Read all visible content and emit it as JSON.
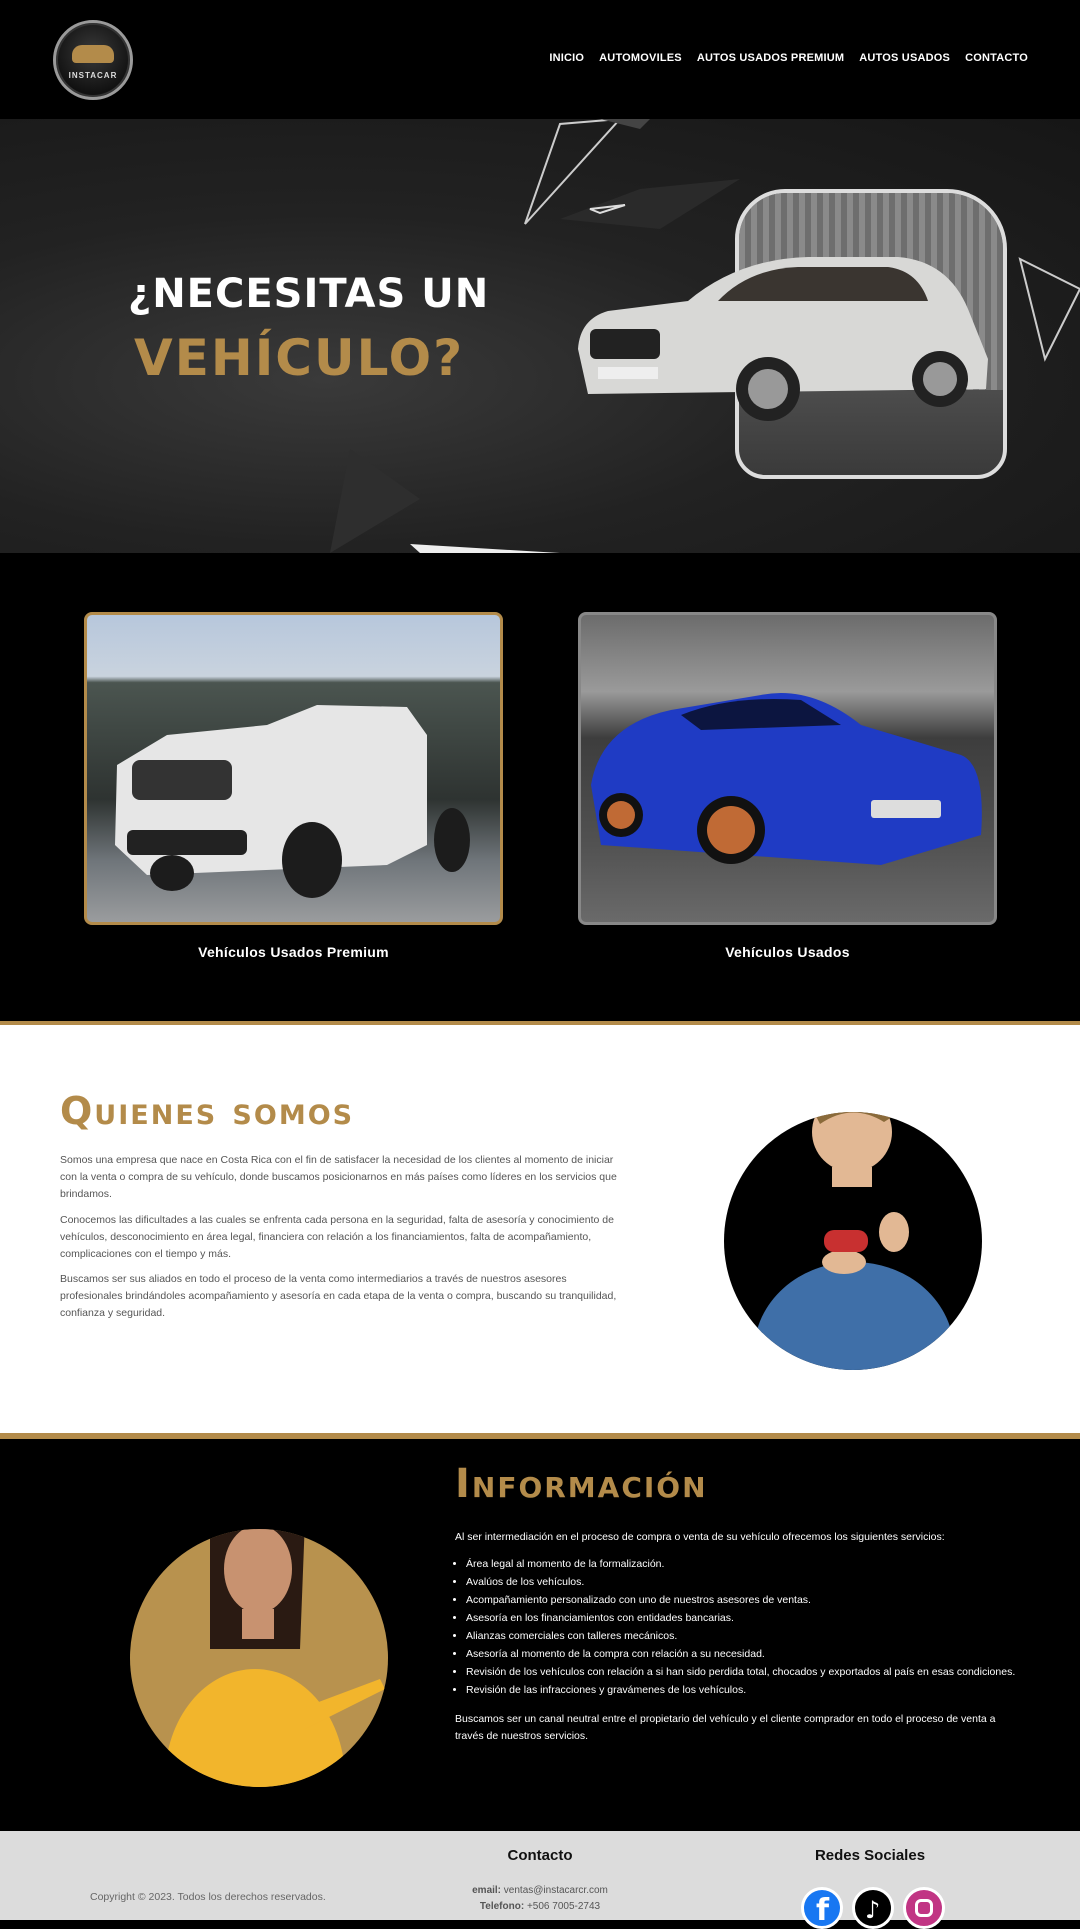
{
  "nav": {
    "logo_text": "INSTACAR",
    "items": [
      "INICIO",
      "AUTOMOVILES",
      "AUTOS USADOS PREMIUM",
      "AUTOS USADOS",
      "CONTACTO"
    ]
  },
  "hero": {
    "line1": "¿NECESITAS UN",
    "line2": "VEHÍCULO?"
  },
  "cards": [
    {
      "label": "Vehículos Usados Premium"
    },
    {
      "label": "Vehículos Usados"
    }
  ],
  "about": {
    "title": "Quienes somos",
    "p1": "Somos una empresa que nace en Costa Rica con el fin de satisfacer la necesidad de los clientes al momento de iniciar con la venta o compra de su vehículo, donde buscamos posicionarnos en más países como líderes en los servicios que brindamos.",
    "p2": "Conocemos las dificultades a las cuales se enfrenta cada persona en la seguridad, falta de asesoría y conocimiento de vehículos, desconocimiento en área legal, financiera con relación a los financiamientos, falta de acompañamiento, complicaciones con el tiempo y más.",
    "p3": "Buscamos ser sus aliados en todo el proceso de la venta como intermediarios a través de nuestros asesores profesionales brindándoles acompañamiento y asesoría en cada etapa de la venta o compra, buscando su tranquilidad, confianza y seguridad."
  },
  "info": {
    "title": "Información",
    "intro": "Al ser intermediación en el proceso de compra o venta de su vehículo ofrecemos los siguientes servicios:",
    "items": [
      "Área legal al momento de la formalización.",
      "Avalúos de los vehículos.",
      "Acompañamiento personalizado con uno de nuestros asesores de ventas.",
      "Asesoría en los financiamientos con entidades bancarias.",
      "Alianzas comerciales con talleres mecánicos.",
      "Asesoría al momento de la compra con relación a su necesidad.",
      "Revisión de los vehículos con relación a si han sido perdida total, chocados y exportados al país en esas condiciones.",
      "Revisión de las infracciones y gravámenes de los vehículos."
    ],
    "outro": "Buscamos ser un canal neutral entre el propietario del vehículo y el cliente comprador en todo el proceso de venta a través de nuestros servicios."
  },
  "footer": {
    "copyright": "Copyright © 2023. Todos los derechos reservados.",
    "contact_title": "Contacto",
    "email_label": "email:",
    "email": "ventas@instacarcr.com",
    "phone_label": "Telefono:",
    "phone": "+506 7005-2743",
    "social_title": "Redes Sociales",
    "social": [
      "facebook-icon",
      "tiktok-icon",
      "instagram-icon"
    ]
  },
  "colors": {
    "accent": "#b38b4a",
    "bg_dark": "#000000",
    "footer_bg": "#dcdcdc"
  }
}
